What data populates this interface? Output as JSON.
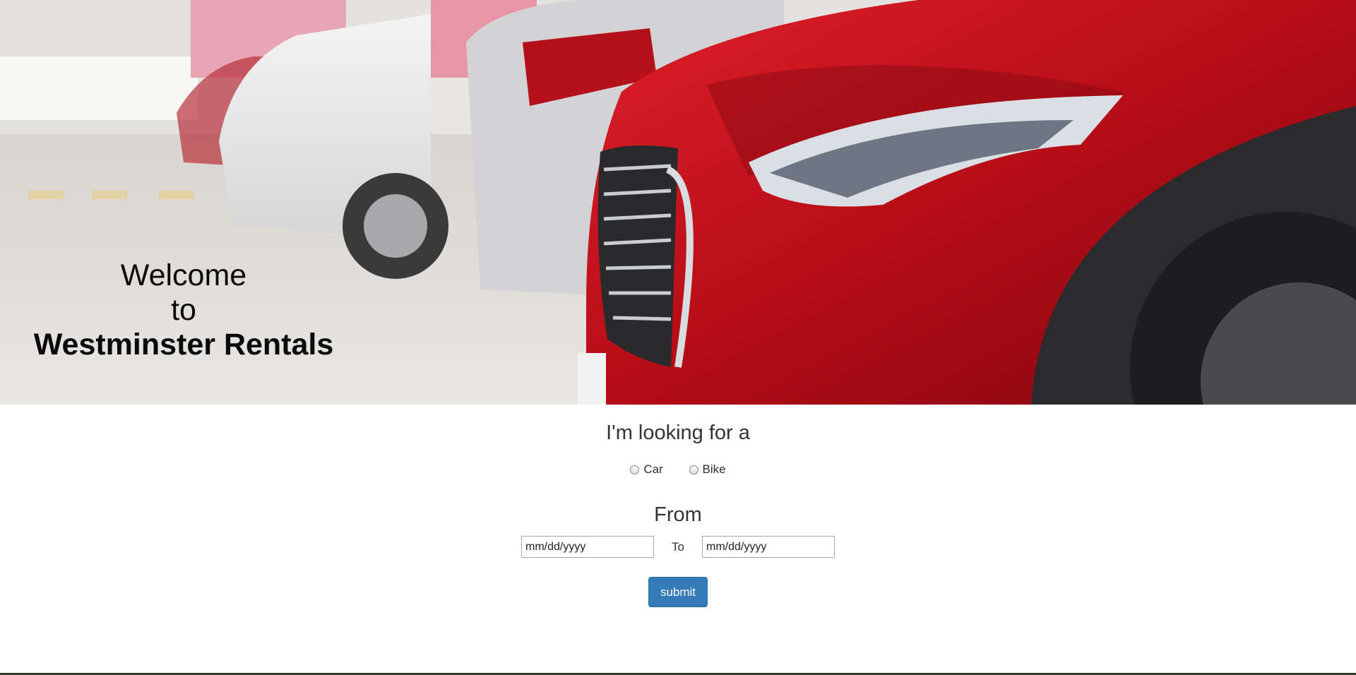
{
  "hero": {
    "image_icon": "red-car-in-parking-garage",
    "welcome": "Welcome",
    "to": "to",
    "brand": "Westminster Rentals"
  },
  "search": {
    "looking_heading": "I'm looking for a",
    "vehicle_options": [
      "Car",
      "Bike"
    ],
    "from_heading": "From",
    "from_placeholder": "mm/dd/yyyy",
    "to_label": "To",
    "to_placeholder": "mm/dd/yyyy",
    "submit_label": "submit"
  },
  "colors": {
    "primary_button": "#337ab7",
    "car_red": "#c4101b"
  }
}
